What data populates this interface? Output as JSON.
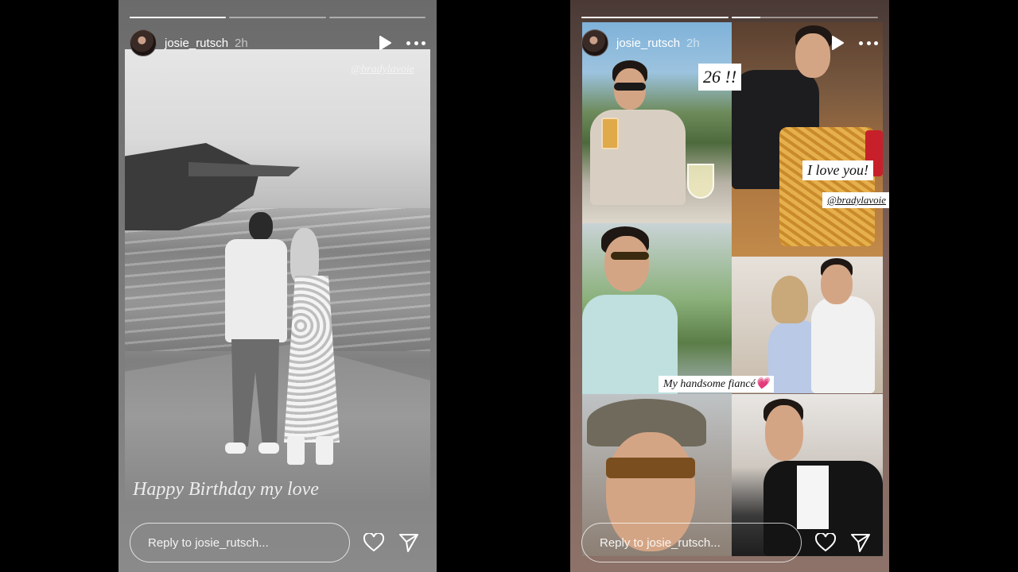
{
  "stories": [
    {
      "username": "josie_rutsch",
      "time": "2h",
      "progress": [
        1.0,
        0.0,
        0.0
      ],
      "mention": "@bradylavoie",
      "caption": "Happy Birthday my love",
      "reply_placeholder": "Reply to josie_rutsch..."
    },
    {
      "username": "josie_rutsch",
      "time": "2h",
      "progress": [
        1.0,
        0.2
      ],
      "stickers": {
        "age": "26 !!",
        "love": "I love you!",
        "mention": "@bradylavoie",
        "fiance": "My handsome fiancé💗"
      },
      "reply_placeholder": "Reply to josie_rutsch..."
    }
  ],
  "icons": {
    "play": "play-icon",
    "more": "more-icon",
    "like": "heart-icon",
    "share": "send-icon"
  }
}
